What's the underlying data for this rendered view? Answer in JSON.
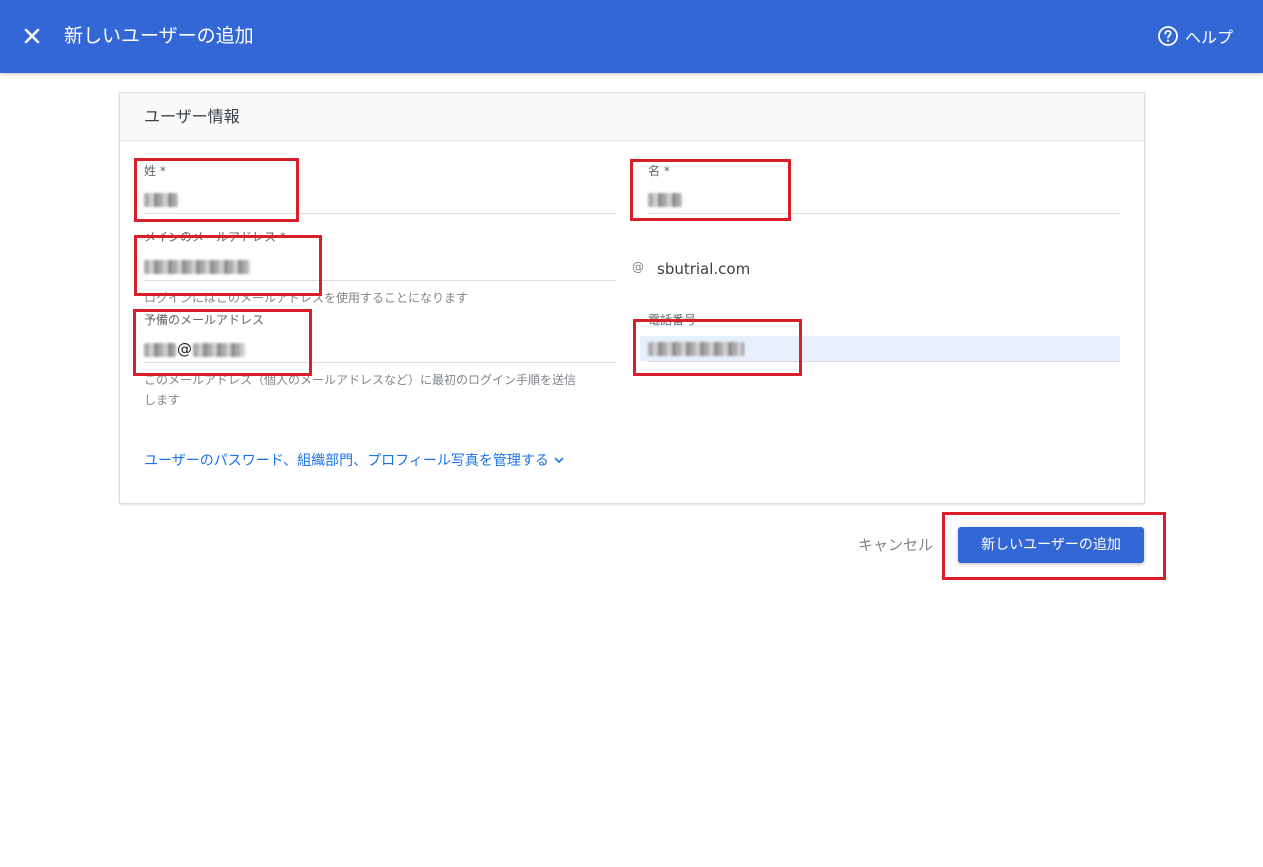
{
  "header": {
    "title": "新しいユーザーの追加",
    "help_label": "ヘルプ"
  },
  "card": {
    "title": "ユーザー情報",
    "last_name": {
      "label": "姓 *"
    },
    "first_name": {
      "label": "名 *"
    },
    "primary_email": {
      "label": "メインのメールアドレス *",
      "helper": "ログインにはこのメールアドレスを使用することになります",
      "domain_prefix": "@",
      "domain": "sbutrial.com"
    },
    "secondary_email": {
      "label": "予備のメールアドレス",
      "at_sign": "@",
      "helper_line1": "このメールアドレス（個人のメールアドレスなど）に最初のログイン手順を送信",
      "helper_line2": "します"
    },
    "phone": {
      "label": "電話番号"
    },
    "manage_link": "ユーザーのパスワード、組織部門、プロフィール写真を管理する"
  },
  "actions": {
    "cancel": "キャンセル",
    "add": "新しいユーザーの追加"
  },
  "colors": {
    "primary": "#3367d6",
    "annotation_red": "#d9202a",
    "link": "#1a73e8"
  }
}
